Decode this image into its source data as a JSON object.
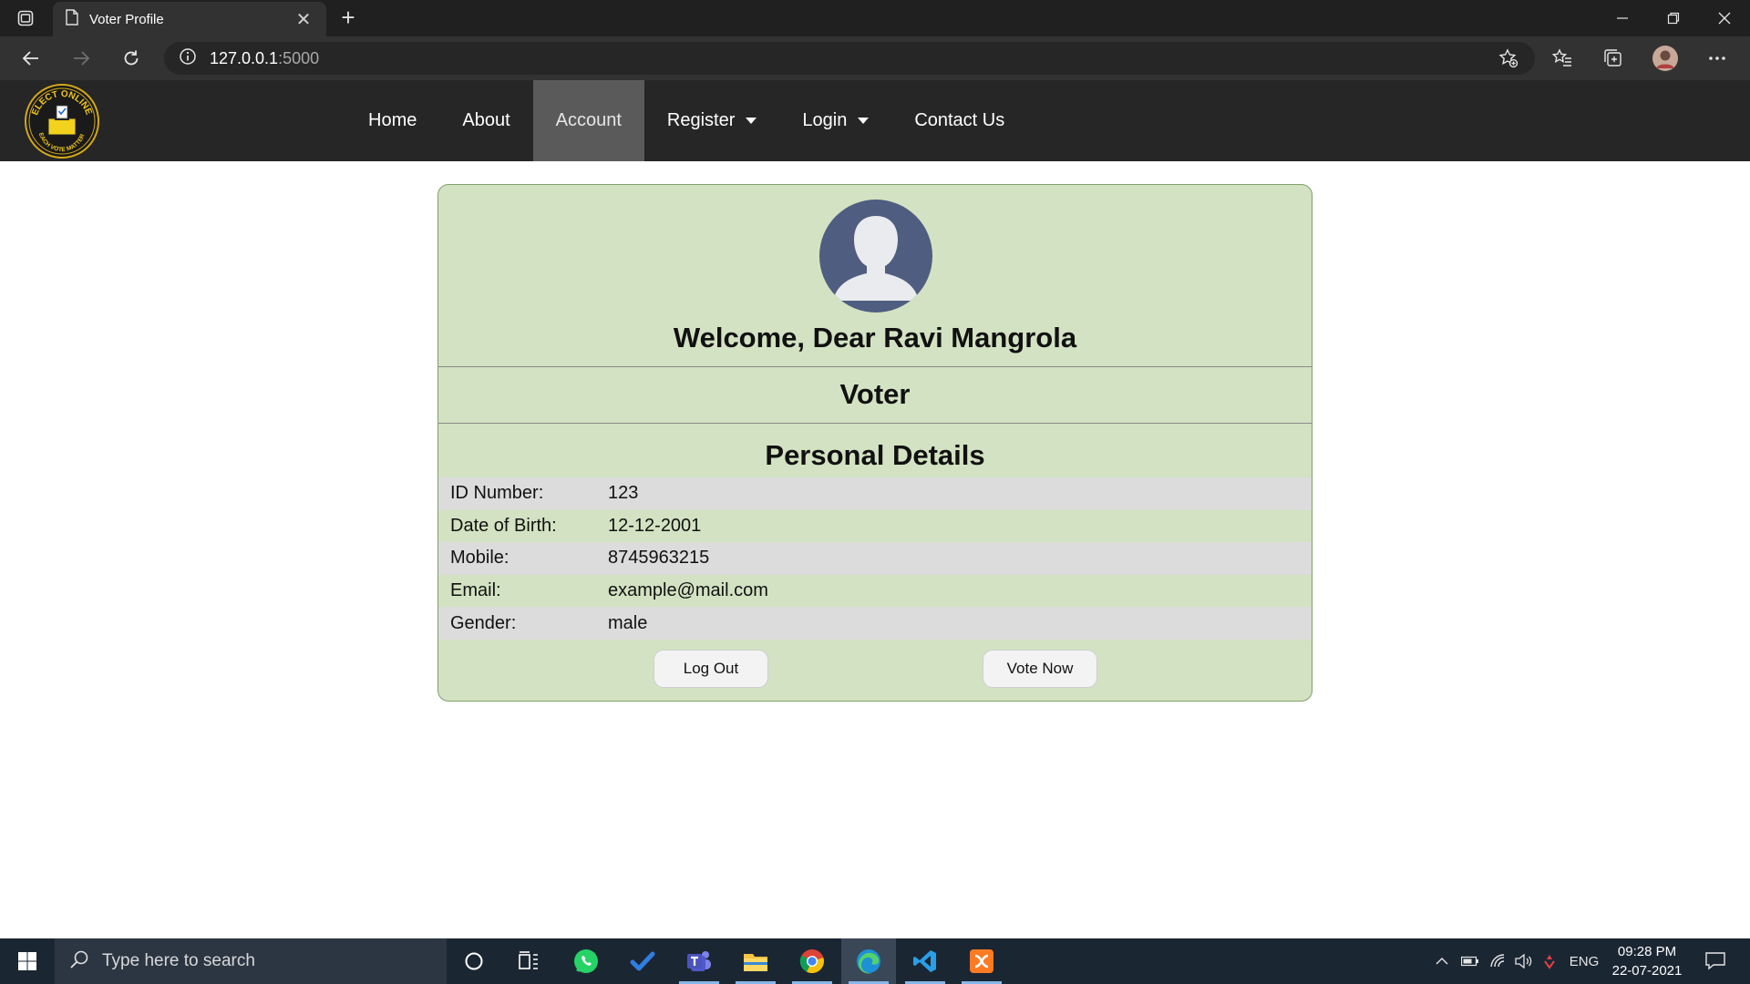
{
  "browser": {
    "tab_title": "Voter Profile",
    "url_host": "127.0.0.1",
    "url_port": ":5000"
  },
  "site": {
    "logo_text_top": "ELECT ONLINE",
    "logo_text_bottom": "EACH VOTE MATTER",
    "nav": [
      {
        "label": "Home"
      },
      {
        "label": "About"
      },
      {
        "label": "Account",
        "active": true
      },
      {
        "label": "Register",
        "dropdown": true
      },
      {
        "label": "Login",
        "dropdown": true
      },
      {
        "label": "Contact Us"
      }
    ]
  },
  "profile": {
    "welcome": "Welcome, Dear Ravi Mangrola",
    "role": "Voter",
    "section_title": "Personal Details",
    "details": [
      {
        "label": "ID Number:",
        "value": "123"
      },
      {
        "label": "Date of Birth:",
        "value": "12-12-2001"
      },
      {
        "label": "Mobile:",
        "value": "8745963215"
      },
      {
        "label": "Email:",
        "value": "example@mail.com"
      },
      {
        "label": "Gender:",
        "value": "male"
      }
    ],
    "logout_label": "Log Out",
    "vote_label": "Vote Now"
  },
  "taskbar": {
    "search_placeholder": "Type here to search",
    "language": "ENG",
    "time": "09:28 PM",
    "date": "22-07-2021"
  },
  "colors": {
    "card_bg": "#d3e2c2",
    "navbar_bg": "#262626",
    "nav_active_bg": "#5a5a5a",
    "avatar_bg": "#4f5d80"
  }
}
